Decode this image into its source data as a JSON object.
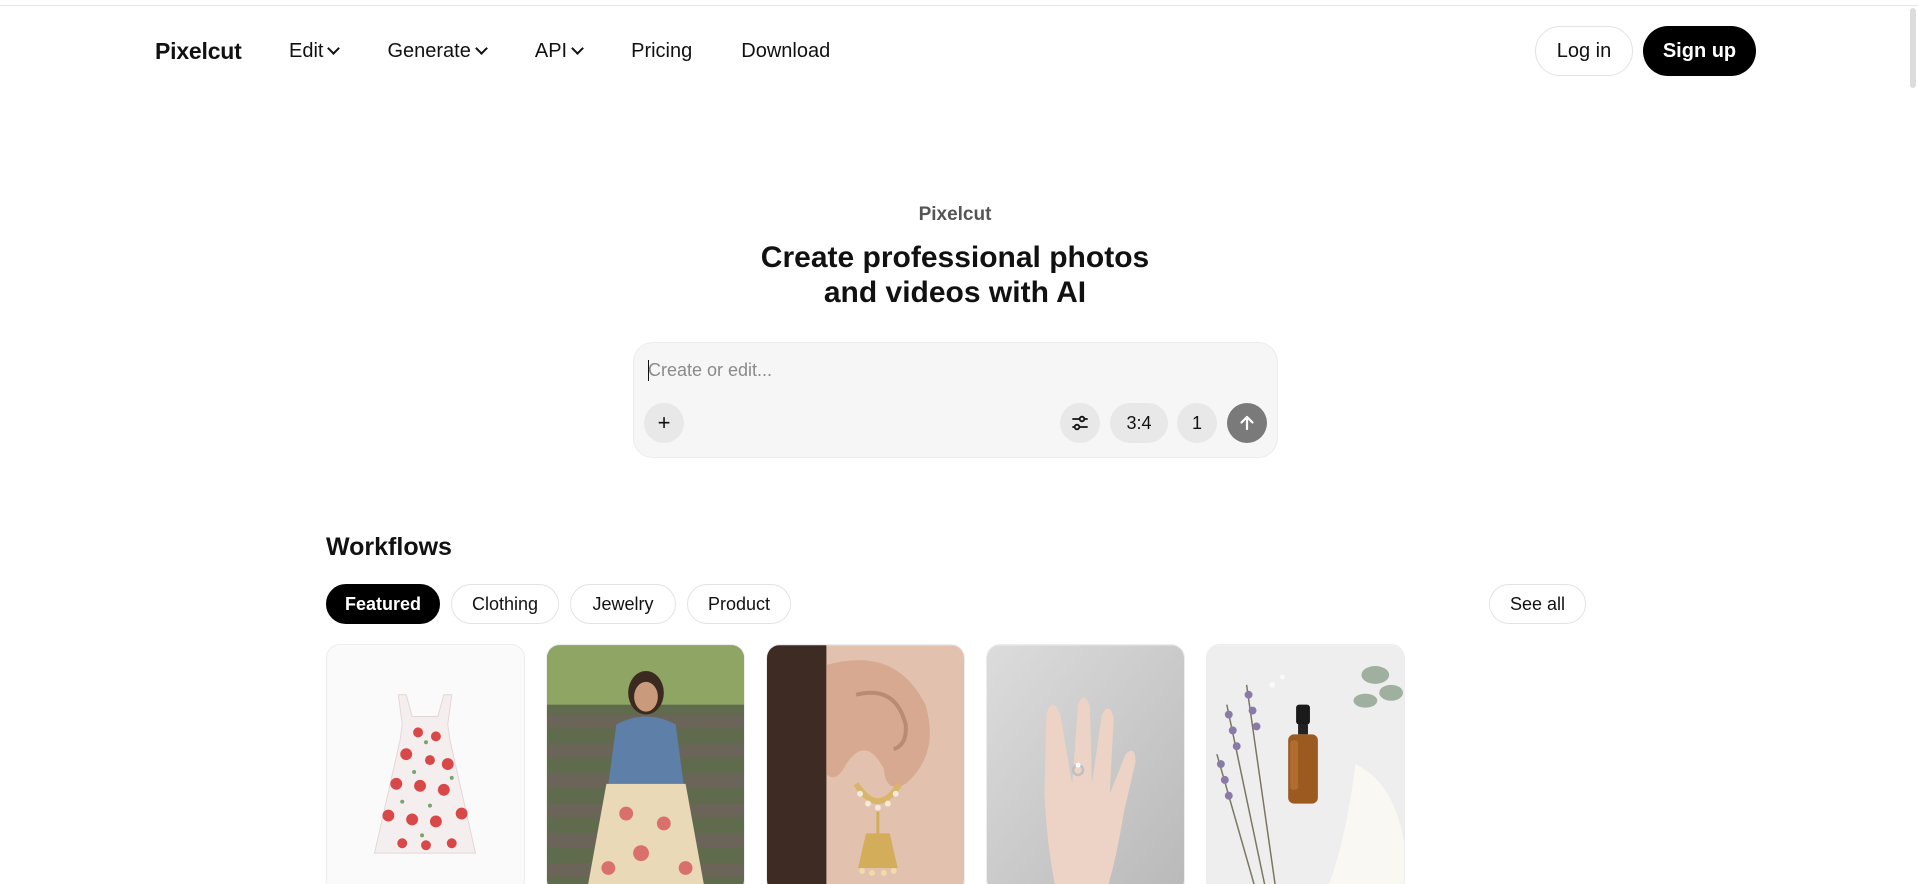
{
  "header": {
    "brand": "Pixelcut",
    "nav": [
      {
        "label": "Edit",
        "dropdown": true
      },
      {
        "label": "Generate",
        "dropdown": true
      },
      {
        "label": "API",
        "dropdown": true
      },
      {
        "label": "Pricing",
        "dropdown": false
      },
      {
        "label": "Download",
        "dropdown": false
      }
    ],
    "login_label": "Log in",
    "signup_label": "Sign up"
  },
  "hero": {
    "eyebrow": "Pixelcut",
    "title_line1": "Create professional photos",
    "title_line2": "and videos with AI"
  },
  "prompt": {
    "placeholder": "Create or edit...",
    "value": "",
    "add_label": "+",
    "settings_icon": "sliders-icon",
    "aspect_ratio": "3:4",
    "count": "1",
    "send_icon": "arrow-up-icon"
  },
  "workflows": {
    "title": "Workflows",
    "filters": [
      "Featured",
      "Clothing",
      "Jewelry",
      "Product"
    ],
    "active_filter": "Featured",
    "see_all_label": "See all",
    "cards": [
      {
        "subject": "floral-dress"
      },
      {
        "subject": "model-on-steps"
      },
      {
        "subject": "earring"
      },
      {
        "subject": "hand-with-ring"
      },
      {
        "subject": "serum-bottle-lavender"
      }
    ]
  },
  "colors": {
    "primary": "#000000",
    "background": "#ffffff",
    "prompt_bg": "#f6f6f6",
    "chip_bg": "#e8e8e8",
    "send_bg": "#7a7a7a"
  }
}
